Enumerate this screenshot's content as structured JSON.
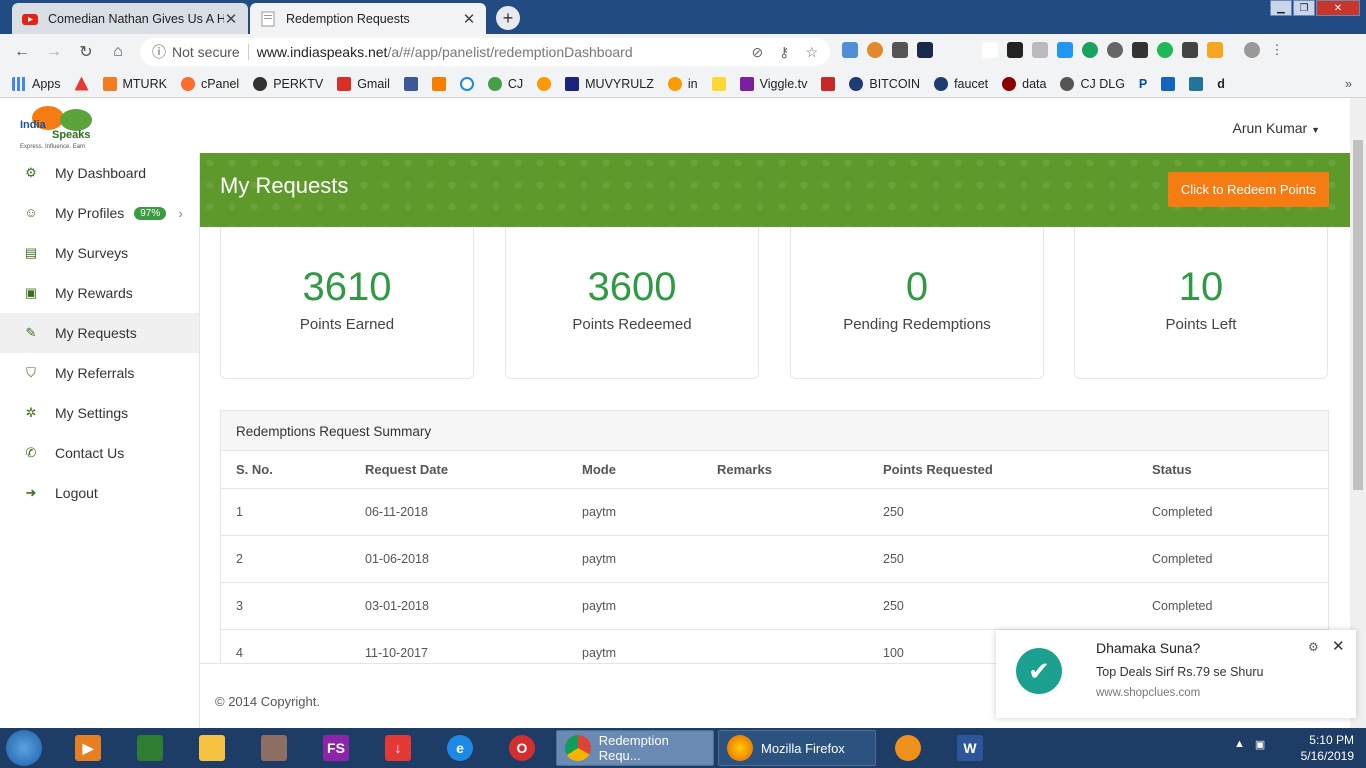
{
  "browser": {
    "tabs": [
      {
        "title": "Comedian Nathan Gives Us A Hil",
        "icon": "youtube-icon"
      },
      {
        "title": "Redemption Requests",
        "icon": "page-icon"
      }
    ],
    "security_label": "Not secure",
    "url_host": "www.indiaspeaks.net",
    "url_path": "/a/#/app/panelist/redemptionDashboard",
    "bookmarks": [
      "Apps",
      "",
      "MTURK",
      "cPanel",
      "PERKTV",
      "Gmail",
      "",
      "",
      "",
      "CJ",
      "",
      "MUVYRULZ",
      "in",
      "",
      "Viggle.tv",
      "",
      "BITCOIN",
      "faucet",
      "data",
      "CJ DLG",
      "P",
      "",
      "",
      "d"
    ],
    "bookmark_more": "»"
  },
  "header": {
    "user_name": "Arun Kumar",
    "logo_line1": "India",
    "logo_line2": "Speaks",
    "logo_tagline": "Express. Influence. Earn"
  },
  "sidebar": {
    "items": [
      {
        "label": "My Dashboard",
        "icon": "dashboard-icon"
      },
      {
        "label": "My Profiles",
        "icon": "user-icon",
        "badge": "97%"
      },
      {
        "label": "My Surveys",
        "icon": "document-icon"
      },
      {
        "label": "My Rewards",
        "icon": "gift-icon"
      },
      {
        "label": "My Requests",
        "icon": "edit-icon"
      },
      {
        "label": "My Referrals",
        "icon": "shield-icon"
      },
      {
        "label": "My Settings",
        "icon": "gears-icon"
      },
      {
        "label": "Contact Us",
        "icon": "phone-icon"
      },
      {
        "label": "Logout",
        "icon": "logout-icon"
      }
    ]
  },
  "banner": {
    "title": "My Requests",
    "redeem_label": "Click to Redeem Points"
  },
  "stats": [
    {
      "value": "3610",
      "label": "Points Earned"
    },
    {
      "value": "3600",
      "label": "Points Redeemed"
    },
    {
      "value": "0",
      "label": "Pending Redemptions"
    },
    {
      "value": "10",
      "label": "Points Left"
    }
  ],
  "summary": {
    "title": "Redemptions Request Summary",
    "columns": [
      "S. No.",
      "Request Date",
      "Mode",
      "Remarks",
      "Points Requested",
      "Status"
    ],
    "rows": [
      [
        "1",
        "06-11-2018",
        "paytm",
        "",
        "250",
        "Completed"
      ],
      [
        "2",
        "01-06-2018",
        "paytm",
        "",
        "250",
        "Completed"
      ],
      [
        "3",
        "03-01-2018",
        "paytm",
        "",
        "250",
        "Completed"
      ],
      [
        "4",
        "11-10-2017",
        "paytm",
        "",
        "100",
        ""
      ]
    ]
  },
  "footer": {
    "copyright": "© 2014 Copyright."
  },
  "notification": {
    "title": "Dhamaka Suna? ",
    "message": "Top Deals Sirf Rs.79 se Shuru",
    "url": "www.shopclues.com"
  },
  "taskbar": {
    "windows": [
      {
        "label": "Redemption Requ...",
        "active": true
      },
      {
        "label": "Mozilla Firefox",
        "active": false
      }
    ],
    "time": "5:10 PM",
    "date": "5/16/2019"
  },
  "colors": {
    "accent_green": "#2f9a43",
    "banner_green": "#5e9a2b",
    "redeem_orange": "#f57c12"
  }
}
